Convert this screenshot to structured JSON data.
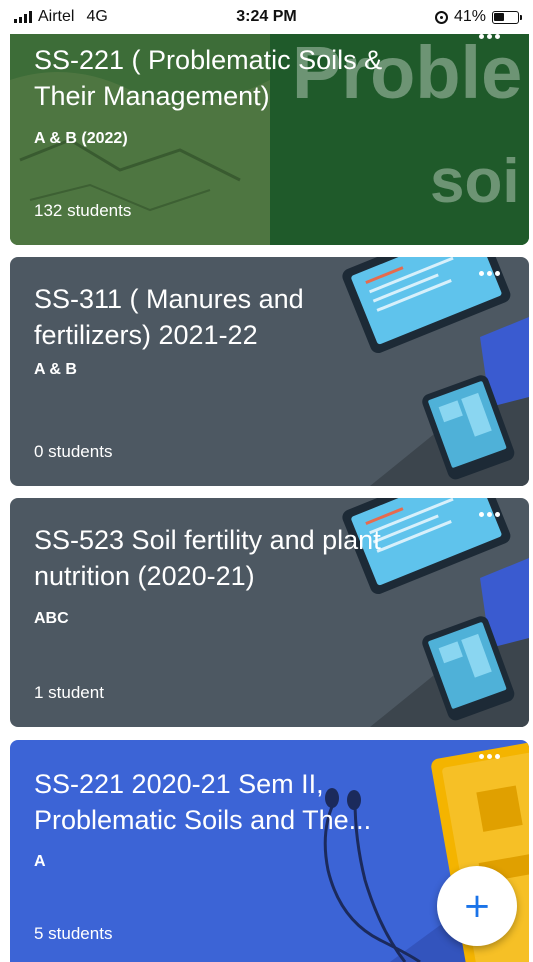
{
  "status_bar": {
    "carrier": "Airtel",
    "network": "4G",
    "time": "3:24 PM",
    "battery": "41%"
  },
  "classes": [
    {
      "title": "SS-221 ( Problematic Soils & Their Management)",
      "section": "A & B (2022)",
      "students": "132 students",
      "watermark_top": "Proble",
      "watermark_bottom": "soi"
    },
    {
      "title": "SS-311 ( Manures and fertilizers) 2021-22",
      "section": "A & B",
      "students": "0 students"
    },
    {
      "title": "SS-523 Soil fertility and plant nutrition (2020-21)",
      "section": "ABC",
      "students": "1 student"
    },
    {
      "title": "SS-221  2020-21 Sem II, Problematic Soils and The...",
      "section": "A",
      "students": "5 students"
    }
  ],
  "fab": {
    "label": "+"
  },
  "colors": {
    "card1": "#2e6b33",
    "card2": "#4d5862",
    "card3": "#4d5862",
    "card4": "#3c64d6",
    "fab_icon": "#1a73e8"
  }
}
